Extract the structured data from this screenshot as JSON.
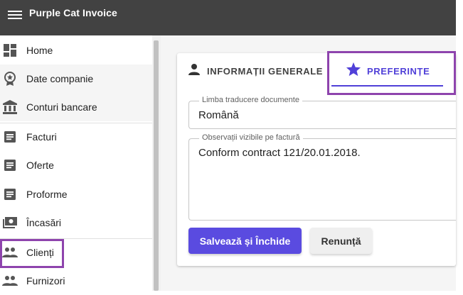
{
  "app": {
    "title": "Purple Cat Invoice",
    "menu_icon": "hamburger-menu-icon"
  },
  "sidebar": {
    "items": [
      {
        "label": "Home",
        "icon": "dashboard-icon"
      },
      {
        "label": "Date companie",
        "icon": "award-badge-icon"
      },
      {
        "label": "Conturi bancare",
        "icon": "bank-icon"
      },
      {
        "label": "Facturi",
        "icon": "document-icon"
      },
      {
        "label": "Oferte",
        "icon": "document-icon"
      },
      {
        "label": "Proforme",
        "icon": "document-icon"
      },
      {
        "label": "Încasări",
        "icon": "cash-icon"
      },
      {
        "label": "Clienți",
        "icon": "people-icon"
      },
      {
        "label": "Furnizori",
        "icon": "people-icon"
      }
    ],
    "highlighted_item": "Clienți"
  },
  "tabs": [
    {
      "label": "INFORMAȚII GENERALE",
      "icon": "person-icon",
      "active": false
    },
    {
      "label": "PREFERINȚE",
      "icon": "star-icon",
      "active": true
    }
  ],
  "form": {
    "language": {
      "label": "Limba traducere documente",
      "value": "Română"
    },
    "observations": {
      "label": "Observații vizibile pe factură",
      "value": "Conform contract 121/20.01.2018."
    }
  },
  "buttons": {
    "save": "Salvează și Închide",
    "cancel": "Renunță"
  },
  "colors": {
    "topbar": "#424242",
    "accent": "#5040d8",
    "highlight_outline": "#8e44ad"
  }
}
